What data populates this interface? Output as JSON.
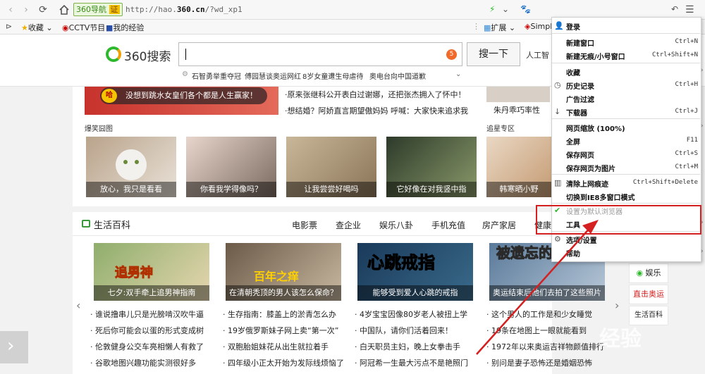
{
  "addressbar": {
    "site_label": "360导航",
    "cert_label": "证",
    "url_prefix": "http://hao.",
    "url_domain": "360.cn",
    "url_suffix": "/?wd_xp1"
  },
  "bookmarks": [
    {
      "label": "收藏"
    },
    {
      "label": "CCTV节目"
    },
    {
      "label": "我的经验"
    },
    {
      "label": "扩展"
    },
    {
      "label": "Simpl"
    }
  ],
  "search": {
    "logo_text": "360搜索",
    "badge": "5",
    "button_label": "搜一下",
    "ai_label": "人工智",
    "hot": [
      "石智勇举重夺冠",
      "傅园慧谈奥运网红",
      "8岁女童遭生母虐待",
      "奥电台向中国道歉"
    ]
  },
  "news": {
    "banner_badge": "哈",
    "banner_text": "没想到跳水女皇们各个都是人生赢家！",
    "lines": [
      "原来张继科公开表白过谢娜，还把张杰拥入了怀中！",
      "想结婚？阿娇直言期望傲妈妈 呼喊：大家快来追求我"
    ],
    "side_caption": "朱丹乖巧率性",
    "label_left": "爆笑囧图",
    "label_right": "追星专区",
    "thumbs": [
      "放心，我只是看看",
      "你看我学得像吗？",
      "让我尝尝好喝吗",
      "它好像在对我竖中指",
      "韩寒晒小野"
    ]
  },
  "life": {
    "title": "生活百科",
    "tabs": [
      "电影票",
      "查企业",
      "娱乐八卦",
      "手机充值",
      "房产家居",
      "健康"
    ],
    "thumbs": [
      "七夕:双手牵上追男神指南",
      "在清朝秃顶的男人该怎么保命？",
      "能够受到爱人心跳的戒指",
      "奥运结束后他们去拍了这些照片"
    ],
    "thumb_titles": [
      "追男神",
      "百年之痒",
      "心跳戒指",
      "被遗忘的奥运村"
    ],
    "columns": [
      [
        "谁说撸串儿只是光膀啃汉吹牛逼",
        "死后你可能会以蛋的形式变成树",
        "伦敦健身公交车亮相懒人有救了",
        "谷歌地图兴趣功能实测很好多"
      ],
      [
        "生存指南：膝盖上的淤青怎么办",
        "19岁俄罗斯妹子网上卖“第一次”",
        "双胞胎姐妹花从出生就拉着手",
        "四年级小正太开始为发际线烦恼了"
      ],
      [
        "4岁宝宝因像80岁老人被扭上学",
        "中国队，请你们活着回来！",
        "白天职员主妇，晚上女拳击手",
        "阿冠希一生最大污点不是艳照门"
      ],
      [
        "这个男人的工作是和少女睡觉",
        "19条在地图上一眼就能看到",
        "1972年以来奥运吉祥物颜值排行",
        "别问是妻子恐怖还是婚姻恐怖"
      ]
    ]
  },
  "side": [
    "娱乐",
    "直击奥运",
    "生活百科"
  ],
  "side_colors": {
    "highlight": "#d42020",
    "green": "#2eb82e"
  },
  "menu": {
    "items": [
      {
        "label": "登录",
        "shortcut": ""
      },
      {
        "label": "新建窗口",
        "shortcut": "Ctrl+N"
      },
      {
        "label": "新建无痕/小号窗口",
        "shortcut": "Ctrl+Shift+N"
      },
      {
        "label": "收藏",
        "shortcut": ""
      },
      {
        "label": "历史记录",
        "shortcut": "Ctrl+H"
      },
      {
        "label": "广告过滤",
        "shortcut": ""
      },
      {
        "label": "下载器",
        "shortcut": "Ctrl+J"
      },
      {
        "label": "网页缩放 (100%)",
        "shortcut": ""
      },
      {
        "label": "全屏",
        "shortcut": "F11"
      },
      {
        "label": "保存网页",
        "shortcut": "Ctrl+S"
      },
      {
        "label": "保存网页为图片",
        "shortcut": "Ctrl+M"
      },
      {
        "label": "清除上网痕迹",
        "shortcut": "Ctrl+Shift+Delete"
      },
      {
        "label": "切换到IE8多窗口模式",
        "shortcut": ""
      },
      {
        "label": "设置为默认浏览器",
        "shortcut": ""
      },
      {
        "label": "工具",
        "shortcut": ""
      },
      {
        "label": "选项/设置",
        "shortcut": ""
      },
      {
        "label": "帮助",
        "shortcut": ""
      }
    ]
  },
  "watermark": "经验"
}
